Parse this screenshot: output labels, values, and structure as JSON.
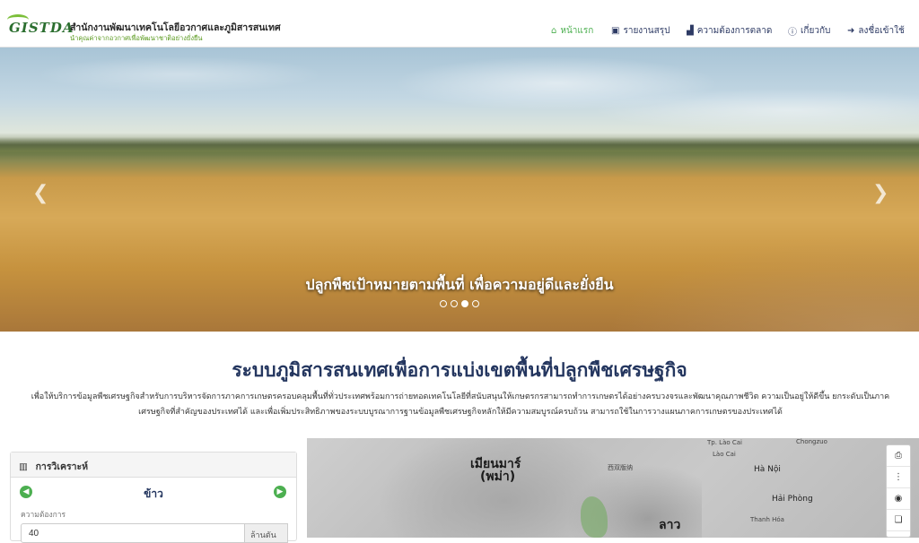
{
  "header": {
    "logo_text": "GISTDA",
    "org_title": "สำนักงานพัฒนาเทคโนโลยีอวกาศและภูมิสารสนเทศ",
    "org_subtitle": "นำคุณค่าจากอวกาศเพื่อพัฒนาชาติอย่างยั่งยืน",
    "nav": [
      {
        "label": "หน้าแรก",
        "icon": "home-icon",
        "active": true
      },
      {
        "label": "รายงานสรุป",
        "icon": "report-icon",
        "active": false
      },
      {
        "label": "ความต้องการตลาด",
        "icon": "chart-icon",
        "active": false
      },
      {
        "label": "เกี่ยวกับ",
        "icon": "info-icon",
        "active": false
      },
      {
        "label": "ลงชื่อเข้าใช้",
        "icon": "sign-in-icon",
        "active": false
      }
    ]
  },
  "hero": {
    "caption": "ปลูกพืชเป้าหมายตามพื้นที่ เพื่อความอยู่ดีและยั่งยืน",
    "slide_count": 4,
    "active_slide": 3,
    "prev_icon": "chevron-left-icon",
    "next_icon": "chevron-right-icon"
  },
  "intro": {
    "headline": "ระบบภูมิสารสนเทศเพื่อการแบ่งเขตพื้นที่ปลูกพืชเศรษฐกิจ",
    "description": "เพื่อให้บริการข้อมูลพืชเศรษฐกิจสำหรับการบริหารจัดการภาคการเกษตรครอบคลุมพื้นที่ทั่วประเทศพร้อมการถ่ายทอดเทคโนโลยีที่สนับสนุนให้เกษตรกรสามารถทำการเกษตรได้อย่างครบวงจรและพัฒนาคุณภาพชีวิต ความเป็นอยู่ให้ดีขึ้น ยกระดับเป็นภาคเศรษฐกิจที่สำคัญของประเทศได้ และเพื่อเพิ่มประสิทธิภาพของระบบบูรณาการฐานข้อมูลพืชเศรษฐกิจหลักให้มีความสมบูรณ์ครบถ้วน สามารถใช้ในการวางแผนภาคการเกษตรของประเทศได้"
  },
  "analysis": {
    "title": "การวิเคราะห์",
    "crop": "ข้าว",
    "need_label": "ความต้องการ",
    "need_value": "40",
    "need_unit": "ล้านตัน"
  },
  "map": {
    "labels": [
      {
        "text": "เมียนมาร์",
        "cls": "big"
      },
      {
        "text": "(พม่า)",
        "cls": "big"
      },
      {
        "text": "ลาว",
        "cls": "big"
      },
      {
        "text": "Hà Nội",
        "cls": ""
      },
      {
        "text": "Hải Phòng",
        "cls": ""
      },
      {
        "text": "Thanh Hóa",
        "cls": "sm"
      },
      {
        "text": "Lào Cai",
        "cls": "sm"
      },
      {
        "text": "Chongzuo",
        "cls": "sm"
      },
      {
        "text": "西双版纳",
        "cls": "sm"
      },
      {
        "text": "Tp. Lào Cai",
        "cls": "sm"
      }
    ],
    "tools": [
      "print-icon",
      "more-icon",
      "eye-icon",
      "layers-icon"
    ]
  }
}
